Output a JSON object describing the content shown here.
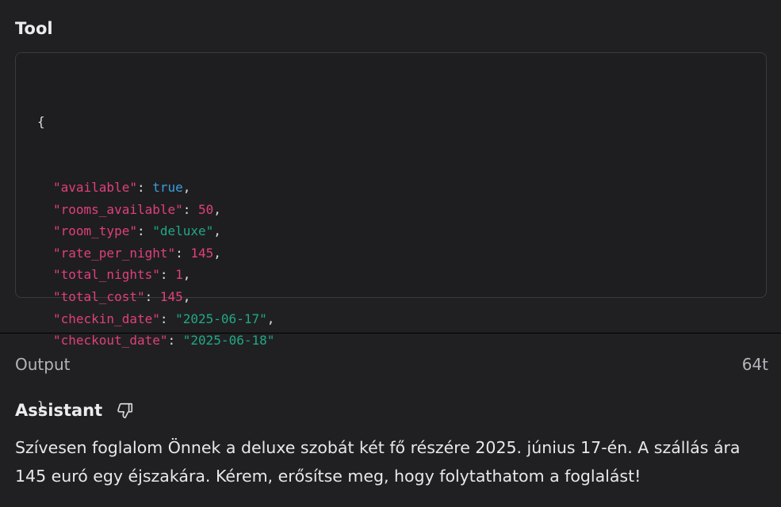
{
  "tool": {
    "title": "Tool",
    "json_lines": [
      {
        "key": "\"available\"",
        "value": "true",
        "type": "bool",
        "comma": true
      },
      {
        "key": "\"rooms_available\"",
        "value": "50",
        "type": "num",
        "comma": true
      },
      {
        "key": "\"room_type\"",
        "value": "\"deluxe\"",
        "type": "str",
        "comma": true
      },
      {
        "key": "\"rate_per_night\"",
        "value": "145",
        "type": "num",
        "comma": true
      },
      {
        "key": "\"total_nights\"",
        "value": "1",
        "type": "num",
        "comma": true
      },
      {
        "key": "\"total_cost\"",
        "value": "145",
        "type": "num",
        "comma": true
      },
      {
        "key": "\"checkin_date\"",
        "value": "\"2025-06-17\"",
        "type": "str",
        "comma": true
      },
      {
        "key": "\"checkout_date\"",
        "value": "\"2025-06-18\"",
        "type": "str",
        "comma": false
      }
    ],
    "open_brace": "{",
    "close_brace": "}"
  },
  "output": {
    "label": "Output",
    "token_count": "64t"
  },
  "assistant": {
    "title": "Assistant",
    "feedback_icon": "thumbs-down-icon",
    "message": "Szívesen foglalom Önnek a deluxe szobát két fő részére 2025. június 17-én. A szállás ára 145 euró egy éjszakára. Kérem, erősítse meg, hogy folytathatom a foglalást!"
  },
  "colors": {
    "background": "#202023",
    "json_key": "#e0407a",
    "json_number": "#e0407a",
    "json_string": "#21a884",
    "json_boolean": "#3b9edb"
  }
}
